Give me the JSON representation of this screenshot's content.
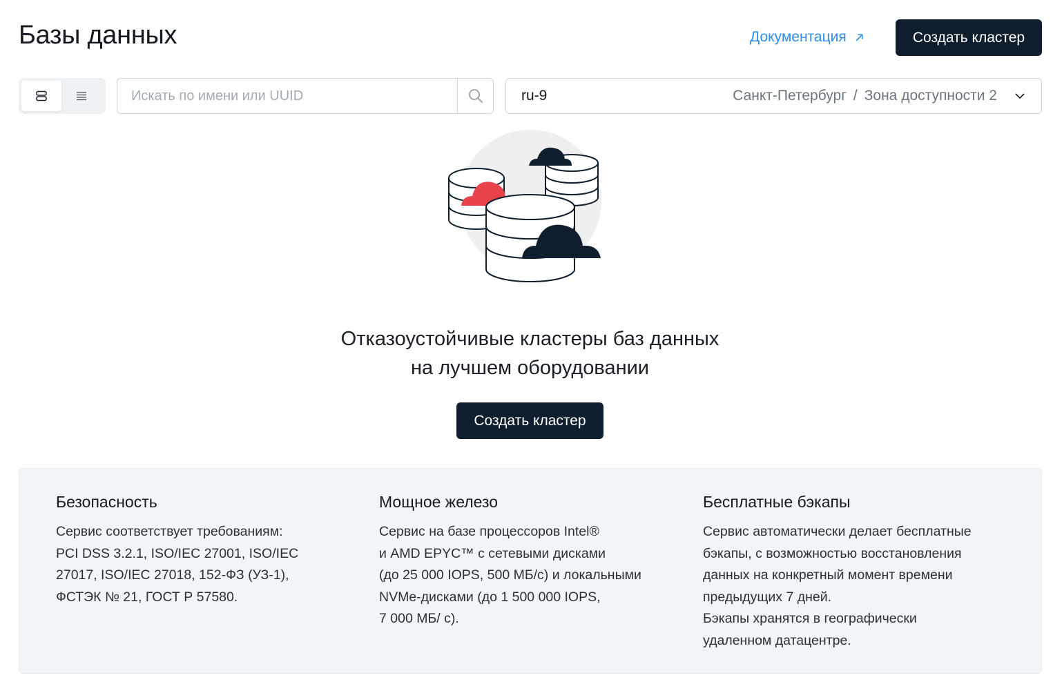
{
  "header": {
    "title": "Базы данных",
    "doc_link": "Документация",
    "create_button": "Создать кластер"
  },
  "toolbar": {
    "view_options": [
      "cards-view-icon",
      "list-view-icon"
    ],
    "active_view": 0,
    "search": {
      "placeholder": "Искать по имени или UUID",
      "value": ""
    },
    "region": {
      "code": "ru-9",
      "city": "Санкт-Петербург",
      "separator": "/",
      "zone": "Зона доступности 2"
    }
  },
  "hero": {
    "title_line1": "Отказоустойчивые кластеры баз данных",
    "title_line2": "на лучшем оборудовании",
    "create_button": "Создать кластер"
  },
  "features": [
    {
      "title": "Безопасность",
      "text": "Сервис соответствует требованиям:\nPCI DSS 3.2.1, ISO/IEC 27001, ISO/IEC\n27017, ISO/IEC 27018, 152-ФЗ (УЗ-1),\nФСТЭК № 21, ГОСТ Р 57580."
    },
    {
      "title": "Мощное железо",
      "text": "Сервис на базе процессоров Intel®\nи AMD EPYC™ с сетевыми дисками\n(до 25 000 IOPS, 500 МБ/с) и локальными\nNVMe-дисками (до 1 500 000 IOPS,\n7 000 МБ/ с)."
    },
    {
      "title": "Бесплатные бэкапы",
      "text": "Сервис автоматически делает бесплатные\nбэкапы, с возможностью восстановления\nданных на конкретный момент времени\nпредыдущих 7 дней.\nБэкапы хранятся в географически\nудаленном датацентре."
    }
  ],
  "colors": {
    "accent_dark": "#0f1f2e",
    "link": "#2f8fe6",
    "cloud_red": "#e8424a"
  }
}
